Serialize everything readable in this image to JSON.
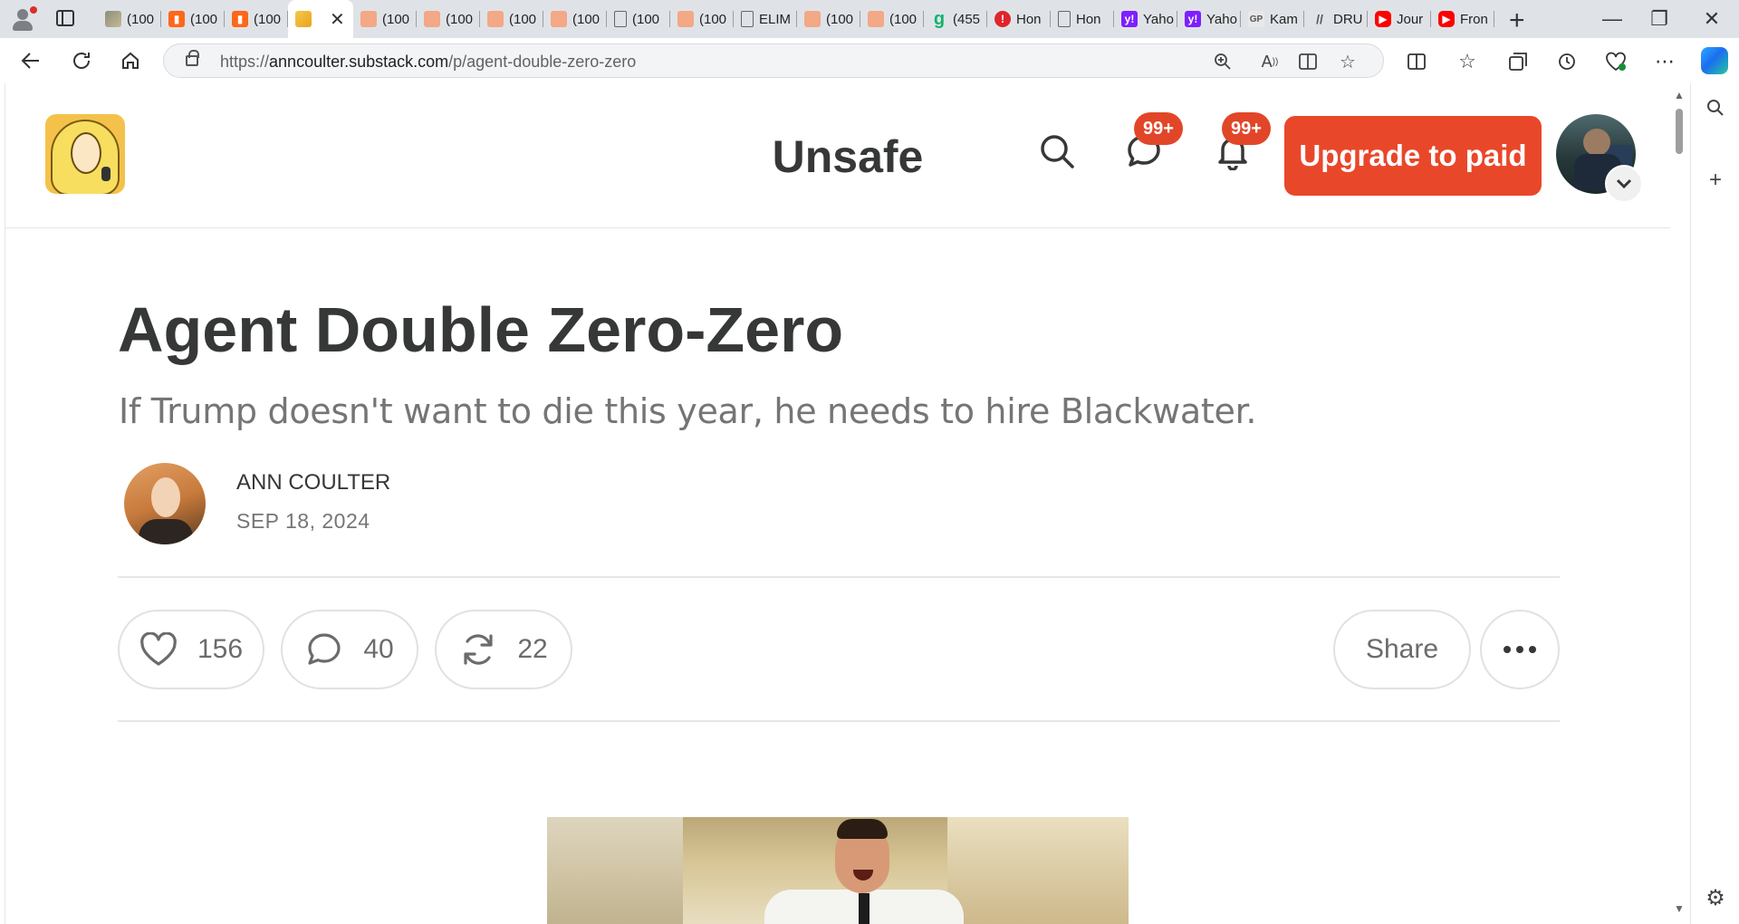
{
  "browser": {
    "tabs": [
      {
        "label": "(100",
        "favicon": "image-favicon"
      },
      {
        "label": "(100",
        "favicon": "substack-favicon"
      },
      {
        "label": "(100",
        "favicon": "substack-favicon"
      },
      {
        "label": "",
        "favicon": "ann-coulter-favicon",
        "active": true
      },
      {
        "label": "(100",
        "favicon": "substack-favicon"
      },
      {
        "label": "(100",
        "favicon": "substack-favicon"
      },
      {
        "label": "(100",
        "favicon": "substack-favicon"
      },
      {
        "label": "(100",
        "favicon": "substack-favicon"
      },
      {
        "label": "(100",
        "favicon": "document-favicon"
      },
      {
        "label": "(100",
        "favicon": "substack-favicon"
      },
      {
        "label": "ELIM",
        "favicon": "document-favicon"
      },
      {
        "label": "(100",
        "favicon": "substack-favicon"
      },
      {
        "label": "(100",
        "favicon": "substack-favicon"
      },
      {
        "label": "(455",
        "favicon": "g-favicon"
      },
      {
        "label": "Hon",
        "favicon": "red-favicon"
      },
      {
        "label": "Hon",
        "favicon": "document-favicon"
      },
      {
        "label": "Yaho",
        "favicon": "yahoo-favicon"
      },
      {
        "label": "Yaho",
        "favicon": "yahoo-favicon"
      },
      {
        "label": "Kam",
        "favicon": "gp-favicon"
      },
      {
        "label": "DRU",
        "favicon": "drudge-favicon"
      },
      {
        "label": "Jour",
        "favicon": "youtube-favicon"
      },
      {
        "label": "Fron",
        "favicon": "youtube-favicon"
      }
    ],
    "url_prefix": "https://",
    "url_host": "anncoulter.substack.com",
    "url_path": "/p/agent-double-zero-zero"
  },
  "site": {
    "publication_name": "Unsafe",
    "chat_badge": "99+",
    "notification_badge": "99+",
    "upgrade_label": "Upgrade to paid"
  },
  "post": {
    "title": "Agent Double Zero-Zero",
    "subtitle": "If Trump doesn't want to die this year, he needs to hire Blackwater.",
    "author": "ANN COULTER",
    "date": "SEP 18, 2024",
    "likes": "156",
    "comments": "40",
    "restacks": "22",
    "share_label": "Share"
  },
  "colors": {
    "accent": "#e9472a",
    "text": "#363737",
    "muted": "#757575"
  }
}
